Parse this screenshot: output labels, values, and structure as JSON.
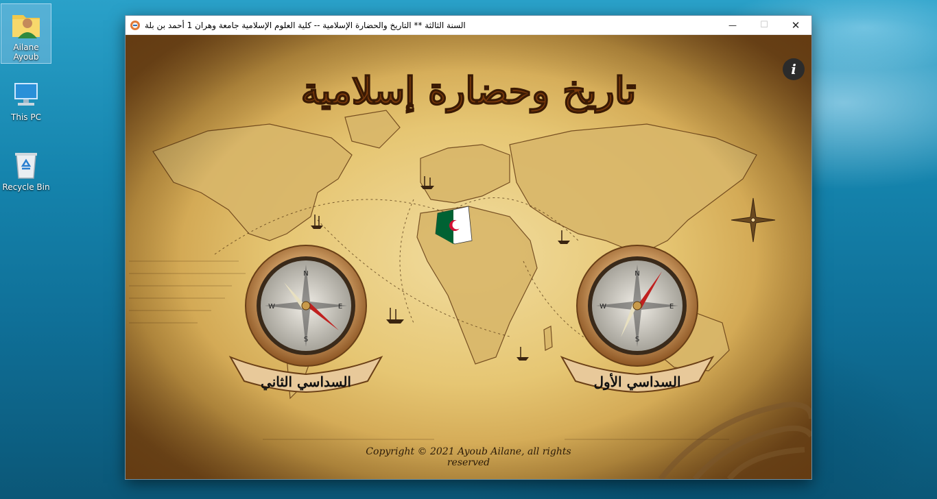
{
  "desktop": {
    "icons": [
      {
        "label": "Ailane Ayoub",
        "icon": "user-folder-icon"
      },
      {
        "label": "This PC",
        "icon": "computer-icon"
      },
      {
        "label": "Recycle Bin",
        "icon": "recycle-bin-icon"
      }
    ]
  },
  "window": {
    "title": "السنة الثالثة ** التاريخ والحضارة الإسلامية -- كلية العلوم الإسلامية جامعة وهران 1 أحمد بن بلة",
    "app_icon": "app-globe-icon",
    "controls": {
      "minimize": "—",
      "maximize": "☐",
      "close": "✕"
    }
  },
  "app": {
    "header_title": "تاريخ وحضارة إسلامية",
    "info_button": "i",
    "semester_second": "السداسي الثاني",
    "semester_first": "السداسي الأول",
    "copyright": "Copyright © 2021 Ayoub Ailane, all rights reserved",
    "colors": {
      "parchment": "#e6c673",
      "ink": "#5a3310",
      "compass_red": "#c0201f",
      "algeria_green": "#006233"
    }
  }
}
